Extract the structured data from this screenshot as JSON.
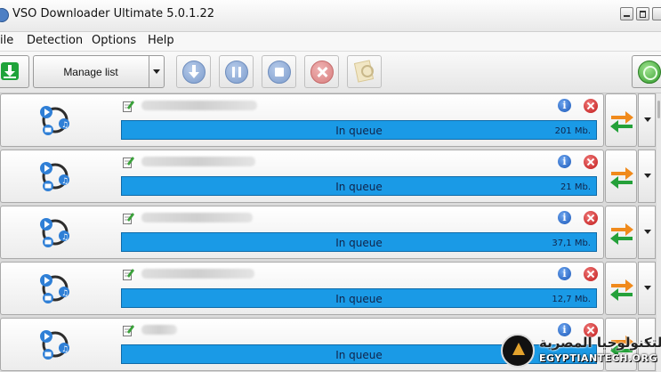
{
  "window": {
    "title": "VSO Downloader Ultimate 5.0.1.22"
  },
  "menu": [
    "ile",
    "Detection",
    "Options",
    "Help"
  ],
  "toolbar": {
    "manage_label": "Manage list",
    "icons": [
      "download-icon",
      "resume-icon",
      "pause-icon",
      "stop-icon",
      "remove-icon",
      "search-icon",
      "globe-icon"
    ]
  },
  "downloads": [
    {
      "status": "In queue",
      "size": "201 Mb.",
      "progress": 0
    },
    {
      "status": "In queue",
      "size": "21 Mb.",
      "progress": 0
    },
    {
      "status": "In queue",
      "size": "37,1 Mb.",
      "progress": 0
    },
    {
      "status": "In queue",
      "size": "12,7 Mb.",
      "progress": 0
    },
    {
      "status": "In queue",
      "size": "",
      "progress": 0
    }
  ],
  "watermark": {
    "arabic": "التكنولوجيا المصرية",
    "latin": "EGYPTIANTECH.ORG"
  },
  "colors": {
    "progress_fill": "#1a9ae6",
    "accent_green": "#1fa33a",
    "delete_red": "#c01818",
    "info_blue": "#1b58b8"
  }
}
